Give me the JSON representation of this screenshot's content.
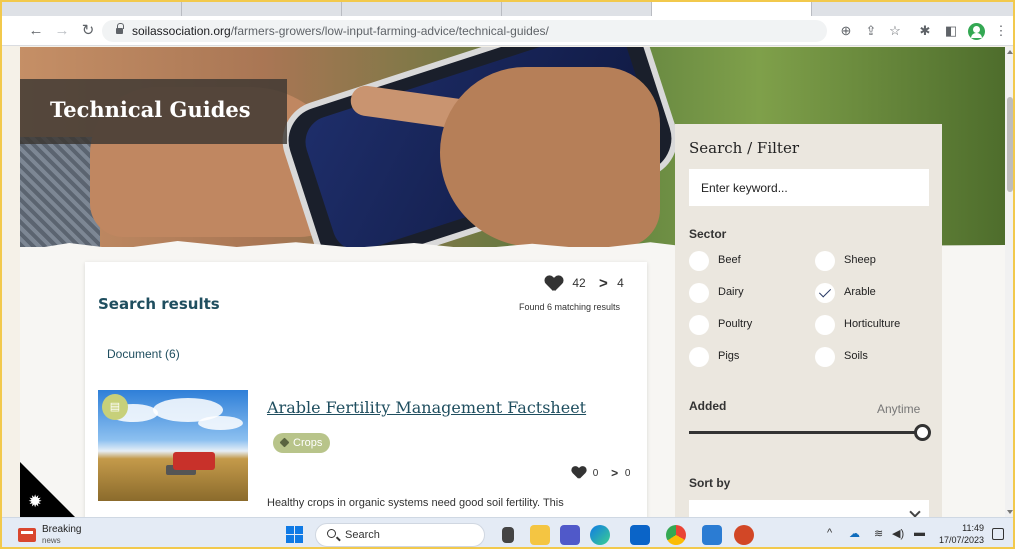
{
  "browser": {
    "url_host": "soilassociation.org",
    "url_path": "/farmers-growers/low-input-farming-advice/technical-guides/"
  },
  "hero": {
    "title": "Technical Guides"
  },
  "results": {
    "heading": "Search results",
    "likes": "42",
    "shares": "4",
    "found": "Found 6 matching results",
    "doc_count": "Document (6)",
    "items": [
      {
        "title": "Arable Fertility Management Factsheet",
        "tag": "Crops",
        "likes": "0",
        "shares": "0",
        "excerpt": "Healthy crops in organic systems need good soil fertility. This"
      }
    ]
  },
  "filter": {
    "heading": "Search / Filter",
    "keyword_placeholder": "Enter keyword...",
    "sector_label": "Sector",
    "sectors": [
      {
        "label": "Beef",
        "checked": false
      },
      {
        "label": "Sheep",
        "checked": false
      },
      {
        "label": "Dairy",
        "checked": false
      },
      {
        "label": "Arable",
        "checked": true
      },
      {
        "label": "Poultry",
        "checked": false
      },
      {
        "label": "Horticulture",
        "checked": false
      },
      {
        "label": "Pigs",
        "checked": false
      },
      {
        "label": "Soils",
        "checked": false
      }
    ],
    "added_label": "Added",
    "added_value": "Anytime",
    "sort_label": "Sort by",
    "sort_value": ""
  },
  "taskbar": {
    "news_title": "Breaking",
    "news_sub": "news",
    "search_label": "Search",
    "time": "11:49",
    "date": "17/07/2023"
  },
  "colors": {
    "heading_teal": "#1f4e5f",
    "tag_green": "#b8c48a",
    "panel_beige": "#ebe7df",
    "frame_yellow": "#f2c94c"
  }
}
